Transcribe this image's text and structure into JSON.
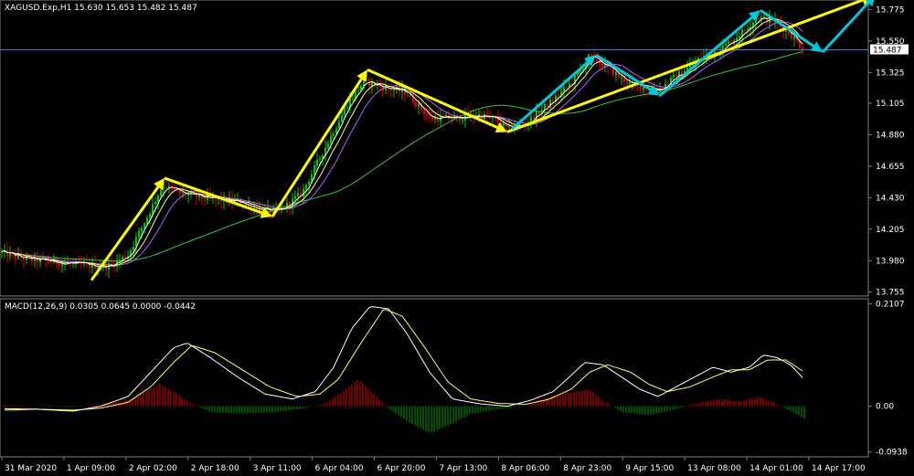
{
  "chart_data": [
    {
      "type": "candlestick",
      "header": "XAGUSD.Exp,H1  15.630 15.653 15.482 15.487",
      "y_ticks": [
        "15.775",
        "15.550",
        "15.325",
        "15.105",
        "14.880",
        "14.655",
        "14.430",
        "14.205",
        "13.980",
        "13.755"
      ],
      "y_tick_values": [
        15.775,
        15.55,
        15.325,
        15.105,
        14.88,
        14.655,
        14.43,
        14.205,
        13.98,
        13.755
      ],
      "ylim": [
        13.74,
        15.83
      ],
      "current_price": 15.487,
      "current_price_label": "15.487",
      "x_ticks": [
        "31 Mar 2020",
        "1 Apr 09:00",
        "2 Apr 02:00",
        "2 Apr 18:00",
        "3 Apr 11:00",
        "6 Apr 04:00",
        "6 Apr 20:00",
        "7 Apr 13:00",
        "8 Apr 06:00",
        "8 Apr 23:00",
        "9 Apr 15:00",
        "13 Apr 08:00",
        "14 Apr 01:00",
        "14 Apr 17:00"
      ],
      "price_path": [
        [
          0,
          14.04
        ],
        [
          30,
          13.99
        ],
        [
          60,
          13.97
        ],
        [
          90,
          13.95
        ],
        [
          118,
          13.94
        ],
        [
          140,
          14.02
        ],
        [
          160,
          14.28
        ],
        [
          178,
          14.52
        ],
        [
          198,
          14.46
        ],
        [
          230,
          14.42
        ],
        [
          260,
          14.4
        ],
        [
          290,
          14.34
        ],
        [
          305,
          14.33
        ],
        [
          330,
          14.46
        ],
        [
          355,
          14.78
        ],
        [
          380,
          15.1
        ],
        [
          398,
          15.26
        ],
        [
          420,
          15.22
        ],
        [
          445,
          15.18
        ],
        [
          470,
          15.0
        ],
        [
          500,
          15.0
        ],
        [
          525,
          15.02
        ],
        [
          545,
          14.98
        ],
        [
          555,
          14.92
        ],
        [
          575,
          14.96
        ],
        [
          600,
          15.1
        ],
        [
          625,
          15.25
        ],
        [
          645,
          15.44
        ],
        [
          660,
          15.38
        ],
        [
          690,
          15.24
        ],
        [
          720,
          15.2
        ],
        [
          740,
          15.3
        ],
        [
          765,
          15.42
        ],
        [
          790,
          15.5
        ],
        [
          810,
          15.6
        ],
        [
          828,
          15.72
        ],
        [
          845,
          15.7
        ],
        [
          862,
          15.62
        ],
        [
          878,
          15.5
        ]
      ],
      "annotations": [
        {
          "color": "#ffff00",
          "points": [
            [
              100,
              13.84
            ],
            [
              180,
              14.57
            ]
          ]
        },
        {
          "color": "#ffff00",
          "points": [
            [
              180,
              14.57
            ],
            [
              298,
              14.295
            ]
          ]
        },
        {
          "color": "#ffff00",
          "points": [
            [
              298,
              14.295
            ],
            [
              402,
              15.345
            ]
          ]
        },
        {
          "color": "#ffff00",
          "points": [
            [
              402,
              15.345
            ],
            [
              555,
              14.9
            ]
          ]
        },
        {
          "color": "#ffff00",
          "points": [
            [
              555,
              14.9
            ],
            [
              955,
              15.87
            ]
          ]
        },
        {
          "color": "#00c8dc",
          "points": [
            [
              560,
              14.92
            ],
            [
              652,
              15.45
            ]
          ]
        },
        {
          "color": "#00c8dc",
          "points": [
            [
              652,
              15.45
            ],
            [
              722,
              15.16
            ]
          ]
        },
        {
          "color": "#00c8dc",
          "points": [
            [
              722,
              15.16
            ],
            [
              832,
              15.77
            ]
          ]
        },
        {
          "color": "#00c8dc",
          "points": [
            [
              832,
              15.77
            ],
            [
              900,
              15.47
            ]
          ]
        },
        {
          "color": "#00c8dc",
          "points": [
            [
              900,
              15.47
            ],
            [
              958,
              15.88
            ]
          ]
        }
      ]
    },
    {
      "type": "macd",
      "header": "MACD(12,26,9) 0.0305 0.0645 0.0000 -0.0442",
      "y_ticks": [
        "0.2107",
        "0.00",
        "-0.0938"
      ],
      "y_tick_values": [
        0.2107,
        0.0,
        -0.0938
      ],
      "ylim": [
        -0.1,
        0.215
      ],
      "macd": [
        [
          5,
          -0.005
        ],
        [
          40,
          -0.006
        ],
        [
          80,
          -0.01
        ],
        [
          110,
          0.0
        ],
        [
          140,
          0.02
        ],
        [
          165,
          0.07
        ],
        [
          190,
          0.12
        ],
        [
          205,
          0.13
        ],
        [
          230,
          0.1
        ],
        [
          260,
          0.06
        ],
        [
          290,
          0.025
        ],
        [
          320,
          0.015
        ],
        [
          345,
          0.03
        ],
        [
          365,
          0.08
        ],
        [
          385,
          0.16
        ],
        [
          405,
          0.205
        ],
        [
          425,
          0.2
        ],
        [
          445,
          0.15
        ],
        [
          470,
          0.07
        ],
        [
          495,
          0.015
        ],
        [
          525,
          0.005
        ],
        [
          555,
          0.0
        ],
        [
          580,
          0.012
        ],
        [
          605,
          0.03
        ],
        [
          620,
          0.055
        ],
        [
          640,
          0.09
        ],
        [
          660,
          0.085
        ],
        [
          680,
          0.06
        ],
        [
          700,
          0.035
        ],
        [
          720,
          0.02
        ],
        [
          740,
          0.04
        ],
        [
          760,
          0.06
        ],
        [
          780,
          0.08
        ],
        [
          800,
          0.07
        ],
        [
          820,
          0.08
        ],
        [
          835,
          0.105
        ],
        [
          850,
          0.1
        ],
        [
          865,
          0.085
        ],
        [
          880,
          0.055
        ]
      ],
      "signal": [
        [
          5,
          -0.008
        ],
        [
          40,
          -0.006
        ],
        [
          80,
          -0.008
        ],
        [
          110,
          -0.004
        ],
        [
          140,
          0.008
        ],
        [
          165,
          0.04
        ],
        [
          190,
          0.09
        ],
        [
          210,
          0.125
        ],
        [
          235,
          0.11
        ],
        [
          265,
          0.075
        ],
        [
          295,
          0.04
        ],
        [
          325,
          0.02
        ],
        [
          350,
          0.025
        ],
        [
          370,
          0.055
        ],
        [
          395,
          0.13
        ],
        [
          420,
          0.2
        ],
        [
          440,
          0.185
        ],
        [
          465,
          0.12
        ],
        [
          490,
          0.05
        ],
        [
          515,
          0.015
        ],
        [
          545,
          0.006
        ],
        [
          575,
          0.004
        ],
        [
          600,
          0.014
        ],
        [
          625,
          0.035
        ],
        [
          645,
          0.07
        ],
        [
          665,
          0.085
        ],
        [
          690,
          0.07
        ],
        [
          710,
          0.045
        ],
        [
          730,
          0.03
        ],
        [
          755,
          0.04
        ],
        [
          780,
          0.06
        ],
        [
          800,
          0.075
        ],
        [
          820,
          0.075
        ],
        [
          840,
          0.095
        ],
        [
          860,
          0.095
        ],
        [
          880,
          0.07
        ]
      ],
      "histogram": [
        [
          5,
          0.003
        ],
        [
          40,
          0.0
        ],
        [
          80,
          -0.002
        ],
        [
          110,
          0.004
        ],
        [
          140,
          0.012
        ],
        [
          160,
          0.03
        ],
        [
          175,
          0.045
        ],
        [
          190,
          0.03
        ],
        [
          210,
          0.005
        ],
        [
          230,
          -0.012
        ],
        [
          265,
          -0.015
        ],
        [
          300,
          -0.012
        ],
        [
          330,
          -0.005
        ],
        [
          355,
          0.005
        ],
        [
          375,
          0.03
        ],
        [
          392,
          0.055
        ],
        [
          410,
          0.025
        ],
        [
          425,
          -0.005
        ],
        [
          445,
          -0.03
        ],
        [
          470,
          -0.055
        ],
        [
          490,
          -0.04
        ],
        [
          515,
          -0.015
        ],
        [
          545,
          -0.006
        ],
        [
          575,
          0.0
        ],
        [
          600,
          0.02
        ],
        [
          625,
          0.028
        ],
        [
          645,
          0.035
        ],
        [
          660,
          0.012
        ],
        [
          680,
          -0.012
        ],
        [
          710,
          -0.018
        ],
        [
          735,
          -0.008
        ],
        [
          760,
          0.005
        ],
        [
          785,
          0.015
        ],
        [
          810,
          0.01
        ],
        [
          830,
          0.02
        ],
        [
          850,
          0.005
        ],
        [
          880,
          -0.025
        ]
      ]
    }
  ],
  "colors": {
    "bull": "#00c800",
    "bear": "#e00000",
    "ma_fast": "#ffffff",
    "ma_mid": "#ffff80",
    "ma_slow": "#b060ff",
    "ma_long": "#39c439",
    "macd_line": "#ffffff",
    "signal_line": "#ffff66",
    "hist_pos": "#e00000",
    "hist_neg": "#00a000",
    "grid": "#7f7f7f",
    "price_line": "#5a7fa8"
  }
}
